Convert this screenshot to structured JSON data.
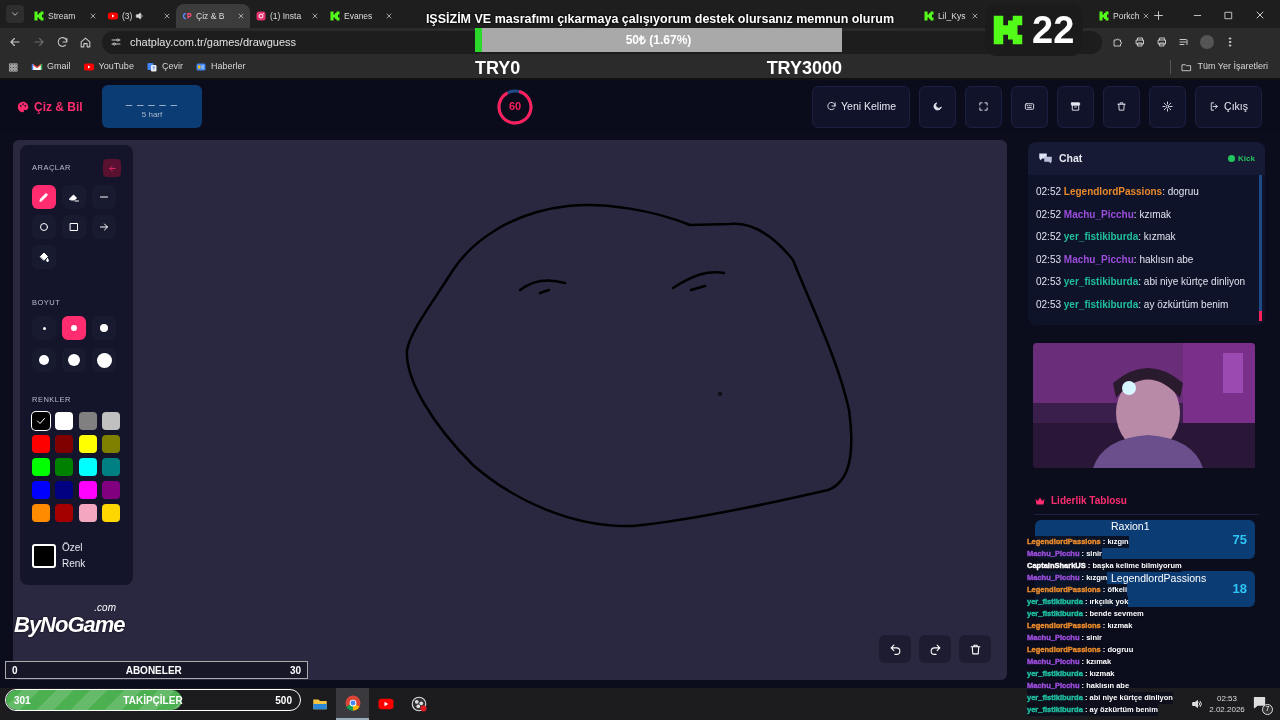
{
  "browser": {
    "tabs": [
      {
        "kind": "kick",
        "label": "Stream",
        "selected": false,
        "audio": false
      },
      {
        "kind": "youtube",
        "label": "(3)",
        "selected": false,
        "audio": true
      },
      {
        "kind": "cp",
        "label": "Çiz & B",
        "selected": true,
        "audio": false
      },
      {
        "kind": "instagram",
        "label": "(1) Insta",
        "selected": false,
        "audio": false
      },
      {
        "kind": "kick",
        "label": "Evanes",
        "selected": false,
        "audio": false
      },
      {
        "kind": "kick",
        "label": "Lil_Kys",
        "selected": false,
        "audio": false
      },
      {
        "kind": "kick",
        "label": "Porkch",
        "selected": false,
        "audio": false
      }
    ],
    "url": "chatplay.com.tr/games/drawguess",
    "bookmarks": [
      {
        "kind": "gmail",
        "label": "Gmail"
      },
      {
        "kind": "youtube",
        "label": "YouTube"
      },
      {
        "kind": "translate",
        "label": "Çevir"
      },
      {
        "kind": "news",
        "label": "Haberler"
      }
    ],
    "all_bookmarks": "Tüm Yer İşaretleri"
  },
  "header": {
    "logo": "Çiz & Bil",
    "word": {
      "blanks": "_ _ _ _ _",
      "hint": "5 harf"
    },
    "timer": "60",
    "actions": [
      {
        "kind": "refresh",
        "label": "Yeni Kelime"
      },
      {
        "kind": "moon"
      },
      {
        "kind": "expand"
      },
      {
        "kind": "keyboard"
      },
      {
        "kind": "archive"
      },
      {
        "kind": "trash"
      },
      {
        "kind": "gear"
      },
      {
        "kind": "logout",
        "label": "Çıkış"
      }
    ]
  },
  "tools": {
    "title": "ARAÇLAR",
    "items": [
      {
        "kind": "pen",
        "selected": true
      },
      {
        "kind": "eraser",
        "selected": false
      },
      {
        "kind": "line",
        "selected": false
      },
      {
        "kind": "circle",
        "selected": false
      },
      {
        "kind": "square",
        "selected": false
      },
      {
        "kind": "arrow",
        "selected": false
      },
      {
        "kind": "bucket",
        "selected": false
      }
    ]
  },
  "size": {
    "title": "BOYUT",
    "items": [
      {
        "selected": false
      },
      {
        "selected": true
      },
      {
        "selected": false
      },
      {
        "selected": false
      },
      {
        "selected": false
      },
      {
        "selected": false
      }
    ]
  },
  "colors": {
    "title": "RENKLER",
    "items": [
      {
        "color": "#000000",
        "selected": true
      },
      {
        "color": "#ffffff",
        "selected": false
      },
      {
        "color": "#808080",
        "selected": false
      },
      {
        "color": "#c0c0c0",
        "selected": false
      },
      {
        "color": "#ff0000",
        "selected": false
      },
      {
        "color": "#800000",
        "selected": false
      },
      {
        "color": "#ffff00",
        "selected": false
      },
      {
        "color": "#808000",
        "selected": false
      },
      {
        "color": "#00ff00",
        "selected": false
      },
      {
        "color": "#008000",
        "selected": false
      },
      {
        "color": "#00ffff",
        "selected": false
      },
      {
        "color": "#008080",
        "selected": false
      },
      {
        "color": "#0000ff",
        "selected": false
      },
      {
        "color": "#000080",
        "selected": false
      },
      {
        "color": "#ff00ff",
        "selected": false
      },
      {
        "color": "#800080",
        "selected": false
      },
      {
        "color": "#ff8c00",
        "selected": false
      },
      {
        "color": "#a50000",
        "selected": false
      },
      {
        "color": "#f4a6c0",
        "selected": false
      },
      {
        "color": "#ffd700",
        "selected": false
      }
    ],
    "custom": "Özel Renk"
  },
  "canvas_actions": [
    {
      "kind": "undo"
    },
    {
      "kind": "redo"
    },
    {
      "kind": "trash"
    }
  ],
  "chat": {
    "title": "Chat",
    "source": "Kick",
    "messages": [
      {
        "time": "02:52",
        "user": "LegendlordPassions",
        "color": "#e8892b",
        "text": ": dogruu"
      },
      {
        "time": "02:52",
        "user": "Machu_Picchu",
        "color": "#9b4ddb",
        "text": ": kzımak"
      },
      {
        "time": "02:52",
        "user": "yer_fistikiburda",
        "color": "#1fbfa0",
        "text": ": kızmak"
      },
      {
        "time": "02:53",
        "user": "Machu_Picchu",
        "color": "#9b4ddb",
        "text": ": haklısın abe"
      },
      {
        "time": "02:53",
        "user": "yer_fistikiburda",
        "color": "#1fbfa0",
        "text": ": abi niye kürtçe dinliyon"
      },
      {
        "time": "02:53",
        "user": "yer_fistikiburda",
        "color": "#1fbfa0",
        "text": ": ay özkürtüm benim"
      }
    ]
  },
  "leaderboard": {
    "title": "Liderlik Tablosu",
    "entries": [
      {
        "name": "Raxion1",
        "score": "75"
      },
      {
        "name": "LegendlordPassions",
        "score": "18"
      }
    ]
  },
  "stream_overlay": {
    "goal": {
      "title": "IŞSİZİM VE masrafımı çıkarmaya çalışıyorum destek olursanız memnun olurum",
      "amount": "50₺ (1.67%)",
      "level": 0.0167,
      "min": "TRY0",
      "max": "TRY3000"
    },
    "kick_followers": "22",
    "brand": {
      "name": "ByNoGame",
      "suffix": ".com"
    },
    "subscribers": {
      "current": "0",
      "label": "ABONELER",
      "max": "30"
    },
    "followers": {
      "current": "301",
      "label": "TAKİPÇİLER",
      "max": "500",
      "level": 0.6
    },
    "chat": [
      {
        "user": "LegendlordPassions",
        "color": "#e8892b",
        "text": ": kızgın"
      },
      {
        "user": "Machu_Picchu",
        "color": "#9b4ddb",
        "text": ": sinir"
      },
      {
        "user": "CaptainSharkUS",
        "color": "#ffffff",
        "text": ": başka kelime bilmiyorum"
      },
      {
        "user": "Machu_Picchu",
        "color": "#9b4ddb",
        "text": ": kızgın"
      },
      {
        "user": "LegendlordPassions",
        "color": "#e8892b",
        "text": ": öfkeli"
      },
      {
        "user": "yer_fistikiburda",
        "color": "#1fbfa0",
        "text": ": ırkçılık yok"
      },
      {
        "user": "yer_fistikiburda",
        "color": "#1fbfa0",
        "text": ": bende sevmem"
      },
      {
        "user": "LegendlordPassions",
        "color": "#e8892b",
        "text": ": kızmak"
      },
      {
        "user": "Machu_Picchu",
        "color": "#9b4ddb",
        "text": ": sinir"
      },
      {
        "user": "LegendlordPassions",
        "color": "#e8892b",
        "text": ": dogruu"
      },
      {
        "user": "Machu_Picchu",
        "color": "#9b4ddb",
        "text": ": kzımak"
      },
      {
        "user": "yer_fistikiburda",
        "color": "#1fbfa0",
        "text": ": kızmak"
      },
      {
        "user": "Machu_Picchu",
        "color": "#9b4ddb",
        "text": ": haklısın abe"
      },
      {
        "user": "yer_fistikiburda",
        "color": "#1fbfa0",
        "text": ": abi niye kürtçe dinliyon"
      },
      {
        "user": "yer_fistikiburda",
        "color": "#1fbfa0",
        "text": ": ay özkürtüm benim"
      }
    ]
  },
  "taskbar": {
    "apps": [
      {
        "kind": "folder",
        "selected": false
      },
      {
        "kind": "chrome",
        "selected": true
      },
      {
        "kind": "youtube",
        "selected": false
      },
      {
        "kind": "obs",
        "selected": false
      }
    ],
    "time": "02:53",
    "date": "2.02.2026",
    "notifications": "7"
  }
}
